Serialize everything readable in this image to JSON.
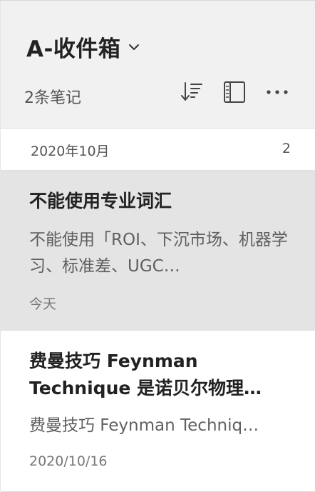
{
  "header": {
    "notebook_title": "A-收件箱",
    "note_count": "2条笔记",
    "icons": {
      "dropdown": "chevron-down-icon",
      "sort": "sort-icon",
      "view": "list-view-icon",
      "more": "more-icon"
    }
  },
  "group": {
    "date_label": "2020年10月",
    "count": "2"
  },
  "notes": [
    {
      "title": "不能使用专业词汇",
      "snippet": "不能使用「ROI、下沉市场、机器学习、标准差、UGC…",
      "date": "今天"
    },
    {
      "title": "费曼技巧 Feynman Technique 是诺贝尔物理…",
      "snippet": "费曼技巧 Feynman Techniq…",
      "date": "2020/10/16"
    }
  ],
  "colors": {
    "header_bg": "#f1f1f1",
    "selected_bg": "#e4e4e4"
  }
}
